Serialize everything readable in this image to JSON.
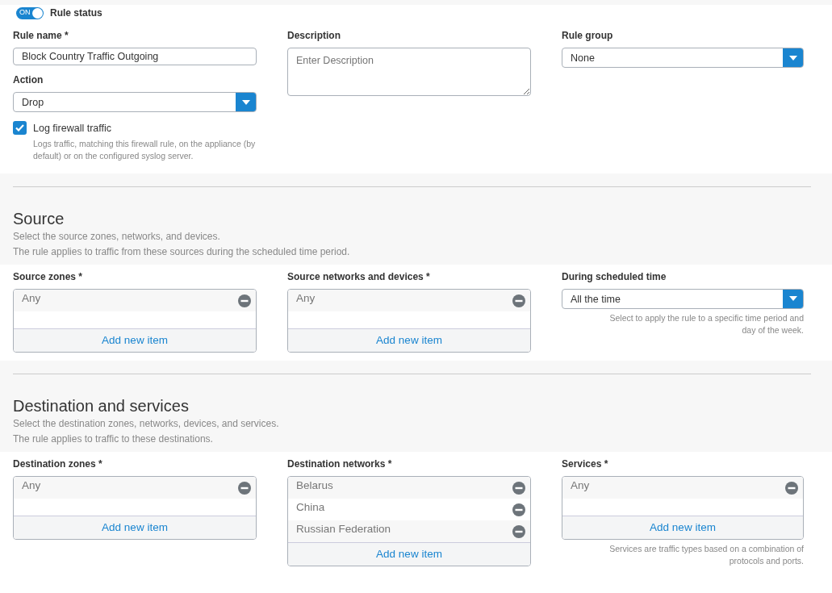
{
  "rule_status": {
    "switch_label": "ON",
    "on": true,
    "label": "Rule status"
  },
  "general": {
    "rule_name": {
      "label": "Rule name *",
      "value": "Block Country Traffic Outgoing"
    },
    "action": {
      "label": "Action",
      "value": "Drop"
    },
    "log": {
      "label": "Log firewall traffic",
      "checked": true,
      "help": "Logs traffic, matching this firewall rule, on the appliance (by default) or on the configured syslog server."
    },
    "description": {
      "label": "Description",
      "placeholder": "Enter Description"
    },
    "rule_group": {
      "label": "Rule group",
      "value": "None"
    }
  },
  "sections": [
    {
      "title": "Source",
      "lines": [
        "Select the source zones, networks, and devices.",
        "The rule applies to traffic from these sources during the scheduled time period."
      ],
      "fields": [
        {
          "kind": "list",
          "label": "Source zones *",
          "items": [
            "Any"
          ],
          "add": "Add new item"
        },
        {
          "kind": "list",
          "label": "Source networks and devices *",
          "items": [
            "Any"
          ],
          "add": "Add new item"
        },
        {
          "kind": "select",
          "label": "During scheduled time",
          "value": "All the time",
          "help": "Select to apply the rule to a specific time period and day of the week."
        }
      ]
    },
    {
      "title": "Destination and services",
      "lines": [
        "Select the destination zones, networks, devices, and services.",
        "The rule applies to traffic to these destinations."
      ],
      "fields": [
        {
          "kind": "list",
          "label": "Destination zones *",
          "items": [
            "Any"
          ],
          "add": "Add new item"
        },
        {
          "kind": "list",
          "label": "Destination networks *",
          "items": [
            "Belarus",
            "China",
            "Russian Federation"
          ],
          "add": "Add new item"
        },
        {
          "kind": "list",
          "label": "Services *",
          "items": [
            "Any"
          ],
          "add": "Add new item",
          "help": "Services are traffic types based on a combination of protocols and ports."
        }
      ]
    }
  ]
}
